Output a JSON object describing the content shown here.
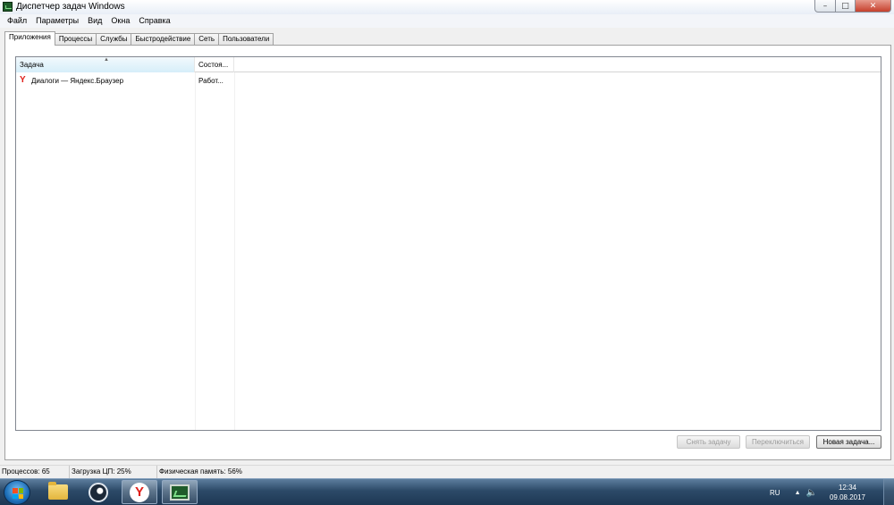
{
  "window": {
    "title": "Диспетчер задач Windows"
  },
  "controls": {
    "minimize": "–",
    "maximize": "□",
    "close": "✕"
  },
  "menu": [
    "Файл",
    "Параметры",
    "Вид",
    "Окна",
    "Справка"
  ],
  "tabs": [
    "Приложения",
    "Процессы",
    "Службы",
    "Быстродействие",
    "Сеть",
    "Пользователи"
  ],
  "list": {
    "columns": {
      "task": "Задача",
      "status": "Состоя..."
    },
    "rows": [
      {
        "task": "Диалоги — Яндекс.Браузер",
        "status": "Работ..."
      }
    ]
  },
  "buttons": {
    "end_task": "Снять задачу",
    "switch_to": "Переключиться",
    "new_task": "Новая задача..."
  },
  "status": {
    "processes": "Процессов: 65",
    "cpu": "Загрузка ЦП: 25%",
    "memory": "Физическая память: 56%"
  },
  "taskbar": {
    "apps": [
      "windows-explorer-icon",
      "steam-icon",
      "yandex-browser-icon",
      "task-manager-icon"
    ],
    "tray": {
      "language": "RU",
      "time": "12:34",
      "date": "09.08.2017"
    }
  },
  "colors": {
    "yandex_red": "#e0201a",
    "taskbar": "#2c4a68",
    "header_highlight": "#d6eef9"
  }
}
